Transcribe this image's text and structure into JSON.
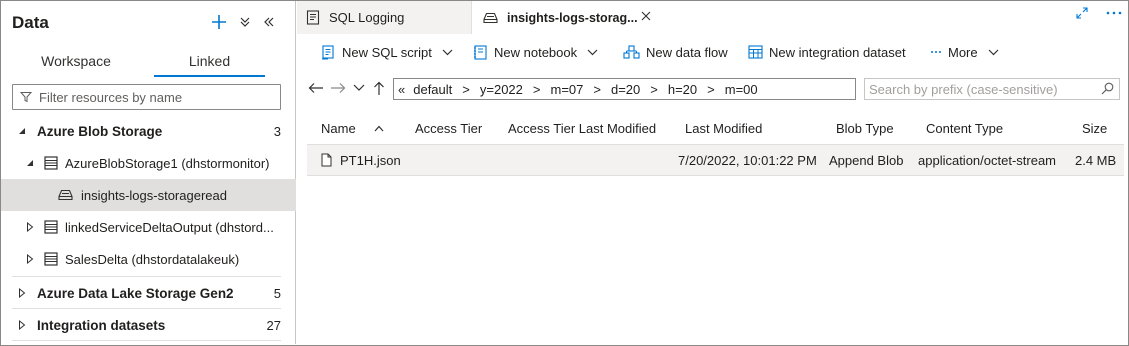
{
  "left_panel": {
    "title": "Data",
    "tabs": {
      "workspace": "Workspace",
      "linked": "Linked"
    },
    "filter_placeholder": "Filter resources by name",
    "tree": [
      {
        "label": "Azure Blob Storage",
        "count": "3"
      },
      {
        "label": "AzureBlobStorage1 (dhstormonitor)"
      },
      {
        "label": "insights-logs-storageread"
      },
      {
        "label": "linkedServiceDeltaOutput (dhstord..."
      },
      {
        "label": "SalesDelta (dhstordatalakeuk)"
      },
      {
        "label": "Azure Data Lake Storage Gen2",
        "count": "5"
      },
      {
        "label": "Integration datasets",
        "count": "27"
      }
    ]
  },
  "doc_tabs": [
    {
      "label": "SQL Logging"
    },
    {
      "label": "insights-logs-storag..."
    }
  ],
  "toolbar": {
    "new_sql_script": "New SQL script",
    "new_notebook": "New notebook",
    "new_data_flow": "New data flow",
    "new_integration_dataset": "New integration dataset",
    "more": "More"
  },
  "path": {
    "collapse": "«",
    "crumbs": [
      "default",
      "y=2022",
      "m=07",
      "d=20",
      "h=20",
      "m=00"
    ],
    "separator": ">",
    "prefix_placeholder": "Search by prefix (case-sensitive)"
  },
  "table": {
    "columns": [
      "Name",
      "Access Tier",
      "Access Tier Last Modified",
      "Last Modified",
      "Blob Type",
      "Content Type",
      "Size"
    ],
    "rows": [
      {
        "name": "PT1H.json",
        "access_tier": "",
        "access_tier_last_modified": "",
        "last_modified": "7/20/2022, 10:01:22 PM",
        "blob_type": "Append Blob",
        "content_type": "application/octet-stream",
        "size": "2.4 MB"
      }
    ]
  },
  "colors": {
    "accent": "#0078d4",
    "selected_row": "#e1dfdd",
    "file_row": "#f3f2f1"
  }
}
